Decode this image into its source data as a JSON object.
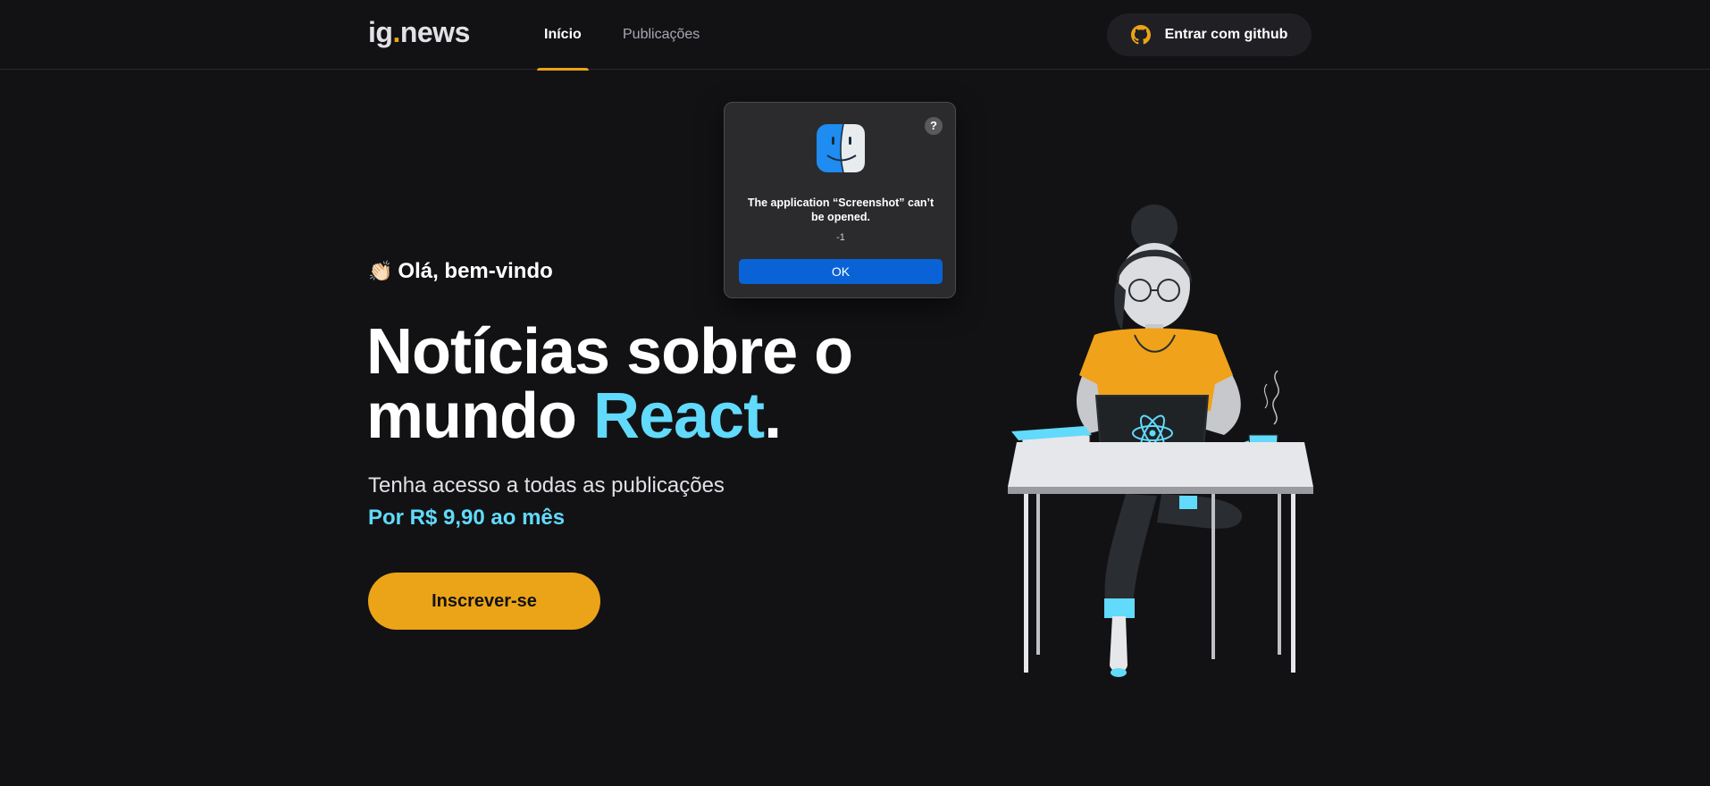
{
  "header": {
    "logo_prefix": "ig",
    "logo_dot": ".",
    "logo_suffix": "news",
    "nav": [
      {
        "label": "Início",
        "active": true
      },
      {
        "label": "Publicações",
        "active": false
      }
    ],
    "signin_label": "Entrar com github",
    "signin_icon": "github-icon"
  },
  "hero": {
    "welcome_emoji": "👏🏻",
    "welcome_text": "Olá, bem-vindo",
    "headline_line1": "Notícias sobre o",
    "headline_line2_prefix": "mundo ",
    "headline_highlight": "React",
    "headline_suffix": ".",
    "subtitle": "Tenha acesso a todas as publicações",
    "price": "Por R$ 9,90 ao mês",
    "subscribe_label": "Inscrever-se",
    "illustration": "woman-coding-illustration"
  },
  "dialog": {
    "icon": "finder-icon",
    "help_label": "?",
    "title": "The application “Screenshot” can’t be opened.",
    "code": "-1",
    "ok_label": "OK"
  },
  "colors": {
    "background": "#121214",
    "accent_yellow": "#eba417",
    "accent_cyan": "#61dafb",
    "dialog_button": "#0a63d6"
  }
}
